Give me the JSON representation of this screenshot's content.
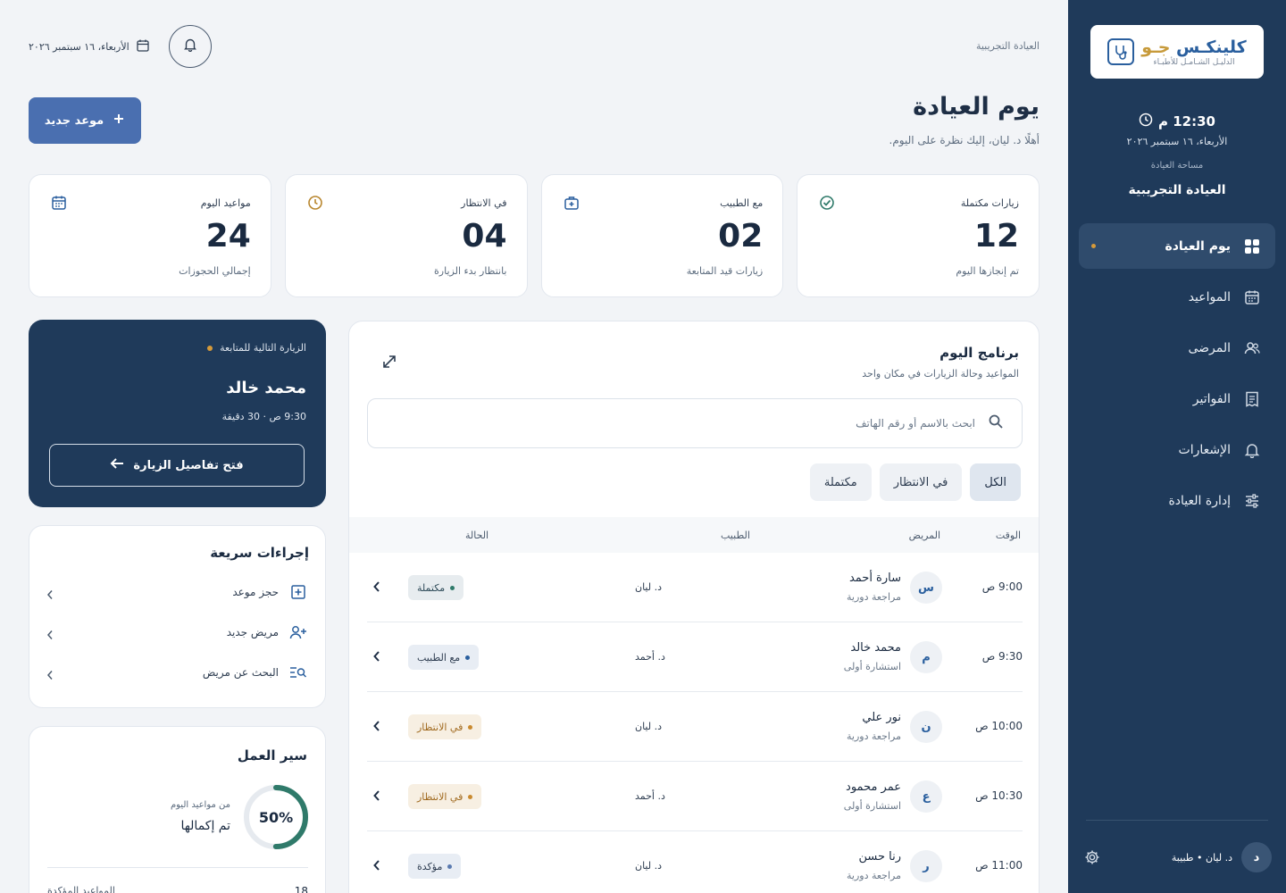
{
  "sidebar": {
    "logo": {
      "main_a": "كلينكـس",
      "main_b": "جـو",
      "sub": "الدليـل الشـامـل للأطبـاء"
    },
    "time": "12:30 م",
    "date": "الأربعاء، ١٦ سبتمبر ٢٠٢٦",
    "space_label": "مساحة العيادة",
    "space_name": "العيادة التجريبية",
    "nav": [
      {
        "label": "يوم العيادة",
        "icon": "grid-icon",
        "active": true
      },
      {
        "label": "المواعيد",
        "icon": "calendar-icon"
      },
      {
        "label": "المرضى",
        "icon": "users-icon"
      },
      {
        "label": "الفواتير",
        "icon": "invoice-icon"
      },
      {
        "label": "الإشعارات",
        "icon": "bell-icon"
      },
      {
        "label": "إدارة العيادة",
        "icon": "sliders-icon"
      }
    ],
    "user": {
      "initial": "د",
      "name": "د. ليان • طبيبة"
    }
  },
  "header": {
    "breadcrumb": "العيادة التجريبية",
    "date": "الأربعاء، ١٦ سبتمبر ٢٠٢٦",
    "title": "يوم العيادة",
    "subtitle": "أهلًا د. ليان، إليك نظرة على اليوم.",
    "new_button": "موعد جديد"
  },
  "stats": [
    {
      "label": "مواعيد اليوم",
      "value": "24",
      "foot": "إجمالي الحجوزات",
      "icon": "calendar-icon",
      "color": "#2a5f9e"
    },
    {
      "label": "في الانتظار",
      "value": "04",
      "foot": "بانتظار بدء الزيارة",
      "icon": "clock-icon",
      "color": "#b8862e"
    },
    {
      "label": "مع الطبيب",
      "value": "02",
      "foot": "زيارات قيد المتابعة",
      "icon": "medical-bag-icon",
      "color": "#2a5f9e"
    },
    {
      "label": "زيارات مكتملة",
      "value": "12",
      "foot": "تم إنجازها اليوم",
      "icon": "check-circle-icon",
      "color": "#2f7a6a"
    }
  ],
  "schedule": {
    "title": "برنامج اليوم",
    "subtitle": "المواعيد وحالة الزيارات في مكان واحد",
    "search_placeholder": "ابحث بالاسم أو رقم الهاتف",
    "filters": [
      "الكل",
      "في الانتظار",
      "مكتملة"
    ],
    "columns": {
      "time": "الوقت",
      "patient": "المريض",
      "doctor": "الطبيب",
      "status": "الحالة"
    },
    "rows": [
      {
        "time": "9:00 ص",
        "initial": "س",
        "name": "سارة أحمد",
        "type": "مراجعة دورية",
        "doctor": "د. ليان",
        "status": "مكتملة",
        "kind": "done"
      },
      {
        "time": "9:30 ص",
        "initial": "م",
        "name": "محمد خالد",
        "type": "استشارة أولى",
        "doctor": "د. أحمد",
        "status": "مع الطبيب",
        "kind": "doc"
      },
      {
        "time": "10:00 ص",
        "initial": "ن",
        "name": "نور علي",
        "type": "مراجعة دورية",
        "doctor": "د. ليان",
        "status": "في الانتظار",
        "kind": "wait"
      },
      {
        "time": "10:30 ص",
        "initial": "ع",
        "name": "عمر محمود",
        "type": "استشارة أولى",
        "doctor": "د. أحمد",
        "status": "في الانتظار",
        "kind": "wait"
      },
      {
        "time": "11:00 ص",
        "initial": "ر",
        "name": "رنا حسن",
        "type": "مراجعة دورية",
        "doctor": "د. ليان",
        "status": "مؤكدة",
        "kind": "conf"
      }
    ]
  },
  "next_visit": {
    "label": "الزيارة التالية للمتابعة",
    "name": "محمد خالد",
    "meta": "9:30 ص · 30 دقيقة",
    "button": "فتح تفاصيل الزيارة"
  },
  "quick_actions": {
    "title": "إجراءات سريعة",
    "items": [
      {
        "label": "حجز موعد",
        "icon": "calendar-plus-icon"
      },
      {
        "label": "مريض جديد",
        "icon": "user-plus-icon"
      },
      {
        "label": "البحث عن مريض",
        "icon": "search-list-icon"
      }
    ]
  },
  "workflow": {
    "title": "سير العمل",
    "percent_label": "50%",
    "percent": 0.5,
    "sub": "من مواعيد اليوم",
    "done": "تم إكمالها",
    "confirmed_label": "المواعيد المؤكدة",
    "confirmed_value": "18"
  }
}
